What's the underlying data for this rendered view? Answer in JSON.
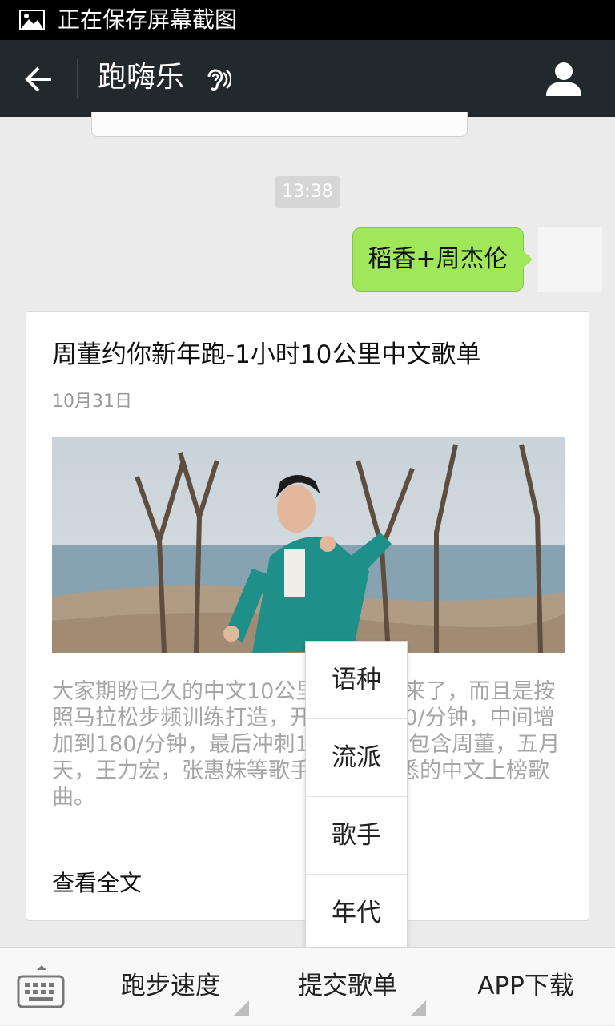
{
  "status_bar": {
    "text": "正在保存屏幕截图"
  },
  "header": {
    "title": "跑嗨乐"
  },
  "chat": {
    "timestamp": "13:38",
    "message": "稻香+周杰伦"
  },
  "article": {
    "title": "周董约你新年跑-1小时10公里中文歌单",
    "date": "10月31日",
    "summary": "大家期盼已久的中文10公里跑步歌单来了，而且是按照马拉松步频训练打造，开始步频170/分钟，中间增加到180/分钟，最后冲刺190/分钟。包含周董，五月天，王力宏，张惠妹等歌手的大家熟悉的中文上榜歌曲。",
    "read_more": "查看全文"
  },
  "popup_menu": {
    "items": [
      "语种",
      "流派",
      "歌手",
      "年代"
    ]
  },
  "bottom_bar": {
    "tabs": [
      "跑步速度",
      "提交歌单",
      "APP下载"
    ]
  },
  "colors": {
    "header_bg": "#22292c",
    "bubble_green": "#a0e75a",
    "page_bg": "#ebebeb"
  }
}
